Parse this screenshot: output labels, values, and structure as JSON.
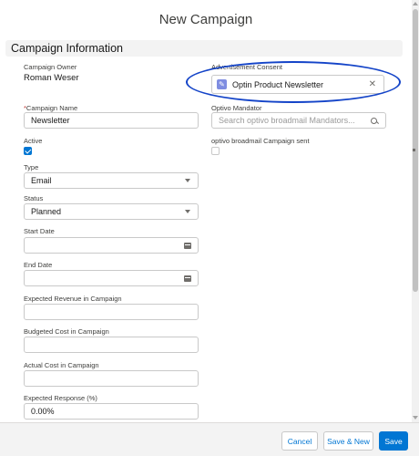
{
  "modal": {
    "title": "New Campaign"
  },
  "section": {
    "title": "Campaign Information"
  },
  "fields": {
    "owner": {
      "label": "Campaign Owner",
      "value": "Roman Weser"
    },
    "ad_consent": {
      "label": "Advertisement Consent",
      "value": "Optin Product Newsletter",
      "icon": "record-icon"
    },
    "name": {
      "required_mark": "*",
      "label": "Campaign Name",
      "value": "Newsletter"
    },
    "optivo_mandator": {
      "label": "Optivo Mandator",
      "placeholder": "Search optivo broadmail Mandators..."
    },
    "active": {
      "label": "Active",
      "checked": true
    },
    "optivo_sent": {
      "label": "optivo broadmail Campaign sent",
      "checked": false
    },
    "type": {
      "label": "Type",
      "value": "Email"
    },
    "status": {
      "label": "Status",
      "value": "Planned"
    },
    "start_date": {
      "label": "Start Date",
      "value": ""
    },
    "end_date": {
      "label": "End Date",
      "value": ""
    },
    "expected_revenue": {
      "label": "Expected Revenue in Campaign",
      "value": ""
    },
    "budgeted_cost": {
      "label": "Budgeted Cost in Campaign",
      "value": ""
    },
    "actual_cost": {
      "label": "Actual Cost in Campaign",
      "value": ""
    },
    "expected_response": {
      "label": "Expected Response (%)",
      "value": "0.00%"
    }
  },
  "footer": {
    "cancel_label": "Cancel",
    "save_new_label": "Save & New",
    "save_label": "Save"
  },
  "colors": {
    "brand": "#0176d3",
    "highlight": "#1444c8",
    "required": "#c23934"
  }
}
